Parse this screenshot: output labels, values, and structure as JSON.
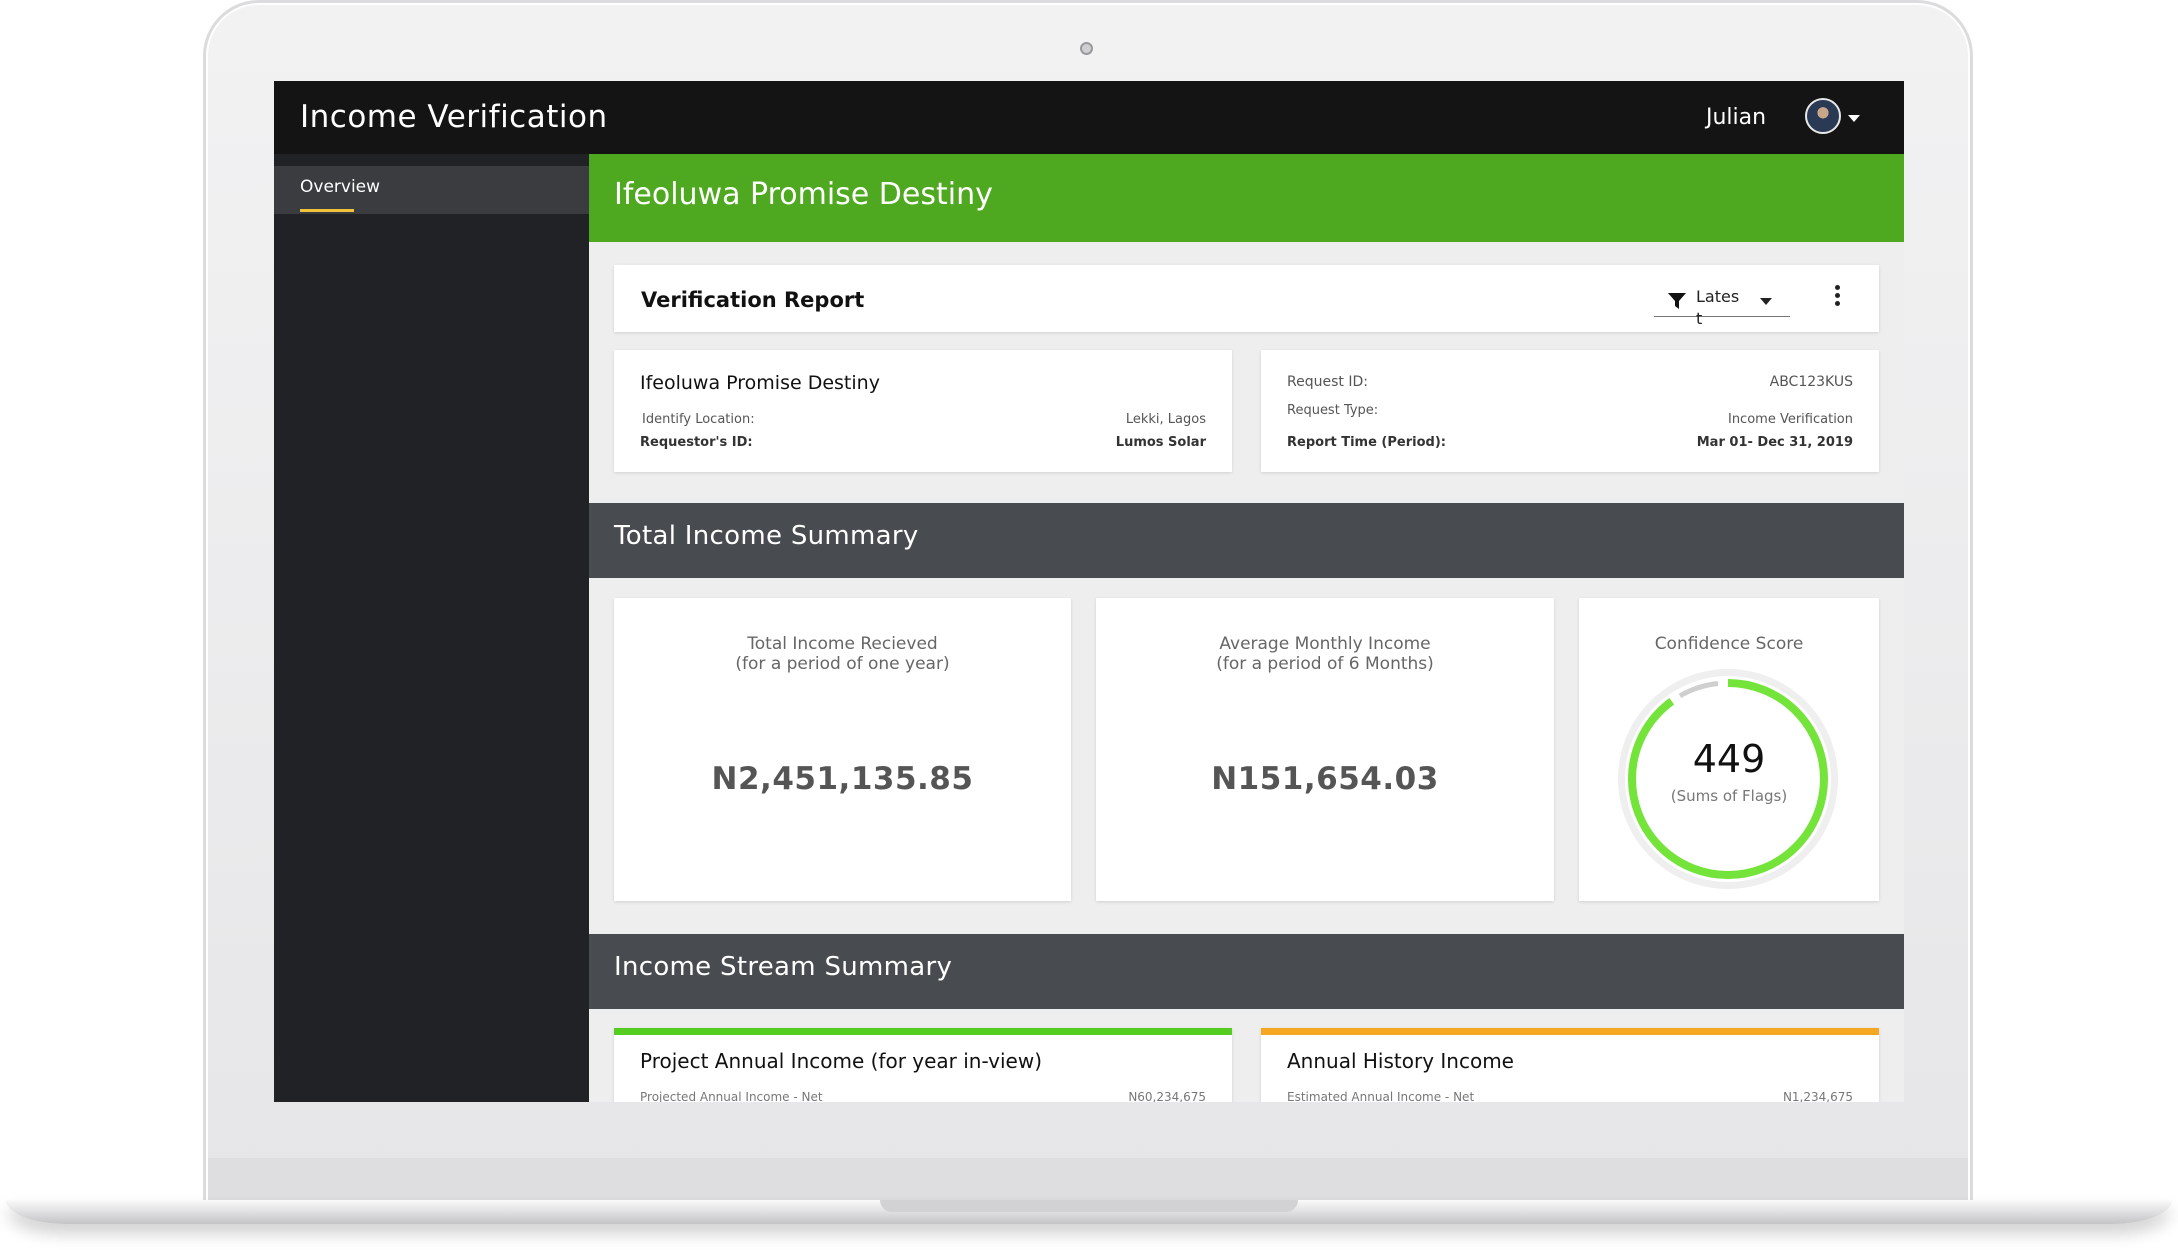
{
  "app": {
    "title": "Income Verification"
  },
  "user": {
    "name": "Julian"
  },
  "sidebar": {
    "items": [
      {
        "label": "Overview",
        "active": true
      }
    ]
  },
  "banner": {
    "name": "Ifeoluwa Promise Destiny",
    "color": "#4ea920"
  },
  "report": {
    "title": "Verification Report",
    "filter_value": "Latest",
    "subject": {
      "name": "Ifeoluwa Promise Destiny",
      "location_label": "Identify Location:",
      "location_value": "Lekki, Lagos",
      "requestor_label": "Requestor's ID:",
      "requestor_value": "Lumos Solar"
    },
    "request": {
      "id_label": "Request ID:",
      "id_value": "ABC123KUS",
      "type_label": "Request Type:",
      "type_value": "Income Verification",
      "period_label": "Report Time (Period):",
      "period_value": "Mar 01- Dec 31, 2019"
    }
  },
  "total_income_summary": {
    "title": "Total Income Summary",
    "cards": [
      {
        "label_line1": "Total Income Recieved",
        "label_line2": "(for a period of one year)",
        "value": "N2,451,135.85"
      },
      {
        "label_line1": "Average Monthly Income",
        "label_line2": "(for a period of 6 Months)",
        "value": "N151,654.03"
      }
    ],
    "confidence": {
      "label": "Confidence Score",
      "score": "449",
      "sub": "(Sums of Flags)",
      "progress_fraction": 0.9,
      "progress_color": "#74e33a",
      "track_color": "#cfcfcf"
    }
  },
  "income_stream_summary": {
    "title": "Income Stream Summary",
    "cards": [
      {
        "title": "Project Annual Income (for year in-view)",
        "label": "Projected Annual Income - Net",
        "value": "N60,234,675",
        "accent": "#55cc22"
      },
      {
        "title": "Annual History Income",
        "label": "Estimated Annual Income - Net",
        "value": "N1,234,675",
        "accent": "#f5a623"
      }
    ]
  }
}
